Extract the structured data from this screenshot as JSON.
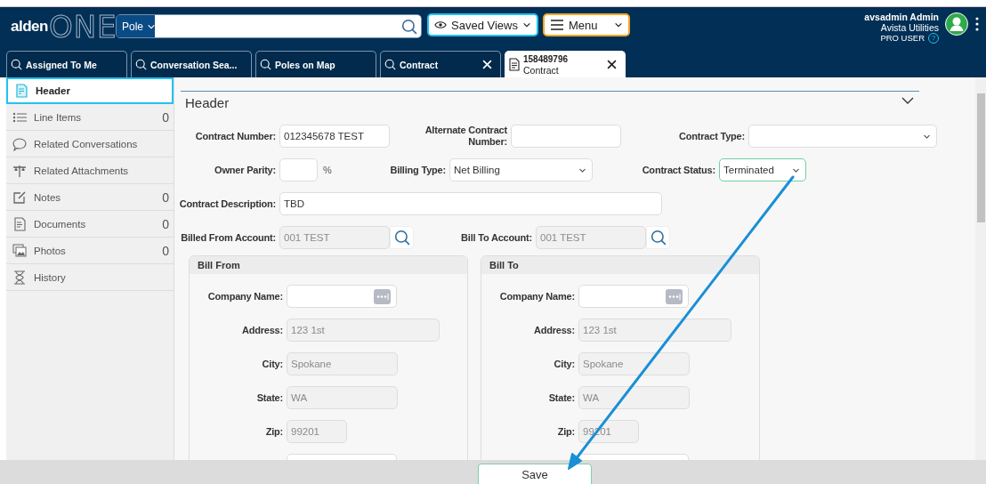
{
  "app": {
    "logo_prefix": "alden",
    "logo_suffix": "ONE"
  },
  "search": {
    "scope": "Pole"
  },
  "toolbar": {
    "saved_views": "Saved Views",
    "menu": "Menu"
  },
  "user": {
    "name": "avsadmin Admin",
    "organization": "Avista Utilities",
    "role": "PRO USER",
    "help": "?"
  },
  "tabs": [
    {
      "kind": "search",
      "label": "Assigned To Me",
      "closable": false,
      "selected": false
    },
    {
      "kind": "search",
      "label": "Conversation Sea...",
      "closable": false,
      "selected": false
    },
    {
      "kind": "search",
      "label": "Poles on Map",
      "closable": false,
      "selected": false
    },
    {
      "kind": "search",
      "label": "Contract",
      "closable": true,
      "selected": false
    },
    {
      "kind": "record",
      "label": "158489796",
      "subtitle": "Contract",
      "closable": true,
      "selected": true
    }
  ],
  "sidebar": {
    "items": [
      {
        "label": "Header",
        "selected": true
      },
      {
        "label": "Line Items",
        "count": "0",
        "selected": false
      },
      {
        "label": "Related Conversations",
        "selected": false
      },
      {
        "label": "Related Attachments",
        "selected": false
      },
      {
        "label": "Notes",
        "count": "0",
        "selected": false
      },
      {
        "label": "Documents",
        "count": "0",
        "selected": false
      },
      {
        "label": "Photos",
        "count": "0",
        "selected": false
      },
      {
        "label": "History",
        "selected": false
      }
    ]
  },
  "section": {
    "title": "Header"
  },
  "form": {
    "rows": [
      [
        {
          "label": "Contract Number:",
          "kind": "text",
          "value": "012345678 TEST",
          "disabled": false,
          "focused": false
        },
        {
          "label": "Alternate Contract Number:",
          "kind": "text",
          "focused": false
        },
        {
          "label": "Contract Type:",
          "kind": "select",
          "focused": false
        }
      ],
      [
        {
          "label": "Owner Parity:",
          "kind": "text",
          "suffix": "%",
          "focused": false
        },
        {
          "label": "Billing Type:",
          "kind": "select",
          "value": "Net Billing",
          "disabled": false,
          "focused": false
        },
        {
          "label": "Contract Status:",
          "kind": "select",
          "value": "Terminated",
          "disabled": false,
          "focused": true
        }
      ],
      [
        {
          "label": "Contract Description:",
          "kind": "text",
          "value": "TBD",
          "disabled": false,
          "focused": false
        }
      ],
      [
        {
          "label": "Billed From Account:",
          "kind": "lookup",
          "value": "001 TEST",
          "disabled": true,
          "focused": false
        },
        {
          "label": "Bill To Account:",
          "kind": "lookup",
          "value": "001 TEST",
          "disabled": true,
          "focused": false
        }
      ]
    ]
  },
  "panels": [
    {
      "title": "Bill From",
      "fields": [
        {
          "label": "Company Name:",
          "kind": "picker"
        },
        {
          "label": "Address:",
          "kind": "text",
          "value": "123 1st",
          "disabled": true
        },
        {
          "label": "City:",
          "kind": "text",
          "value": "Spokane",
          "disabled": true
        },
        {
          "label": "State:",
          "kind": "text",
          "value": "WA",
          "disabled": true
        },
        {
          "label": "Zip:",
          "kind": "text",
          "value": "99201",
          "disabled": true
        },
        {
          "kind": "text"
        }
      ]
    },
    {
      "title": "Bill To",
      "fields": [
        {
          "label": "Company Name:",
          "kind": "picker"
        },
        {
          "label": "Address:",
          "kind": "text",
          "value": "123 1st",
          "disabled": true
        },
        {
          "label": "City:",
          "kind": "text",
          "value": "Spokane",
          "disabled": true
        },
        {
          "label": "State:",
          "kind": "text",
          "value": "WA",
          "disabled": true
        },
        {
          "label": "Zip:",
          "kind": "text",
          "value": "99201",
          "disabled": true
        },
        {
          "kind": "text"
        }
      ]
    }
  ],
  "footer": {
    "buttons": [
      "Save"
    ]
  },
  "annotations": [
    {
      "kind": "arrow"
    }
  ]
}
